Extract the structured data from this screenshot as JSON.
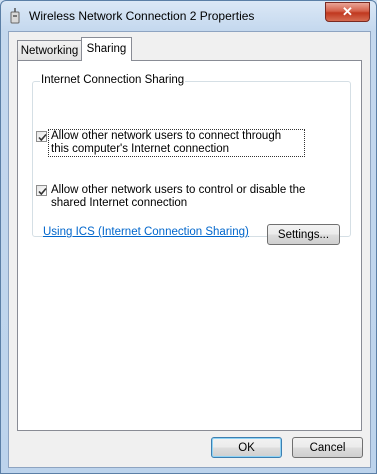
{
  "window": {
    "title": "Wireless Network Connection 2 Properties",
    "close_label": "✕"
  },
  "tabs": [
    {
      "label": "Networking",
      "selected": false
    },
    {
      "label": "Sharing",
      "selected": true
    }
  ],
  "sharing": {
    "group_label": "Internet Connection Sharing",
    "option1": {
      "label": "Allow other network users to connect through this computer's Internet connection",
      "checked": true
    },
    "option2": {
      "label": "Allow other network users to control or disable the shared Internet connection",
      "checked": true
    },
    "help_link": "Using ICS (Internet Connection Sharing)",
    "settings_button": "Settings..."
  },
  "footer": {
    "ok_label": "OK",
    "cancel_label": "Cancel"
  },
  "colors": {
    "accent": "#0066cc",
    "close_button": "#c0381f"
  }
}
